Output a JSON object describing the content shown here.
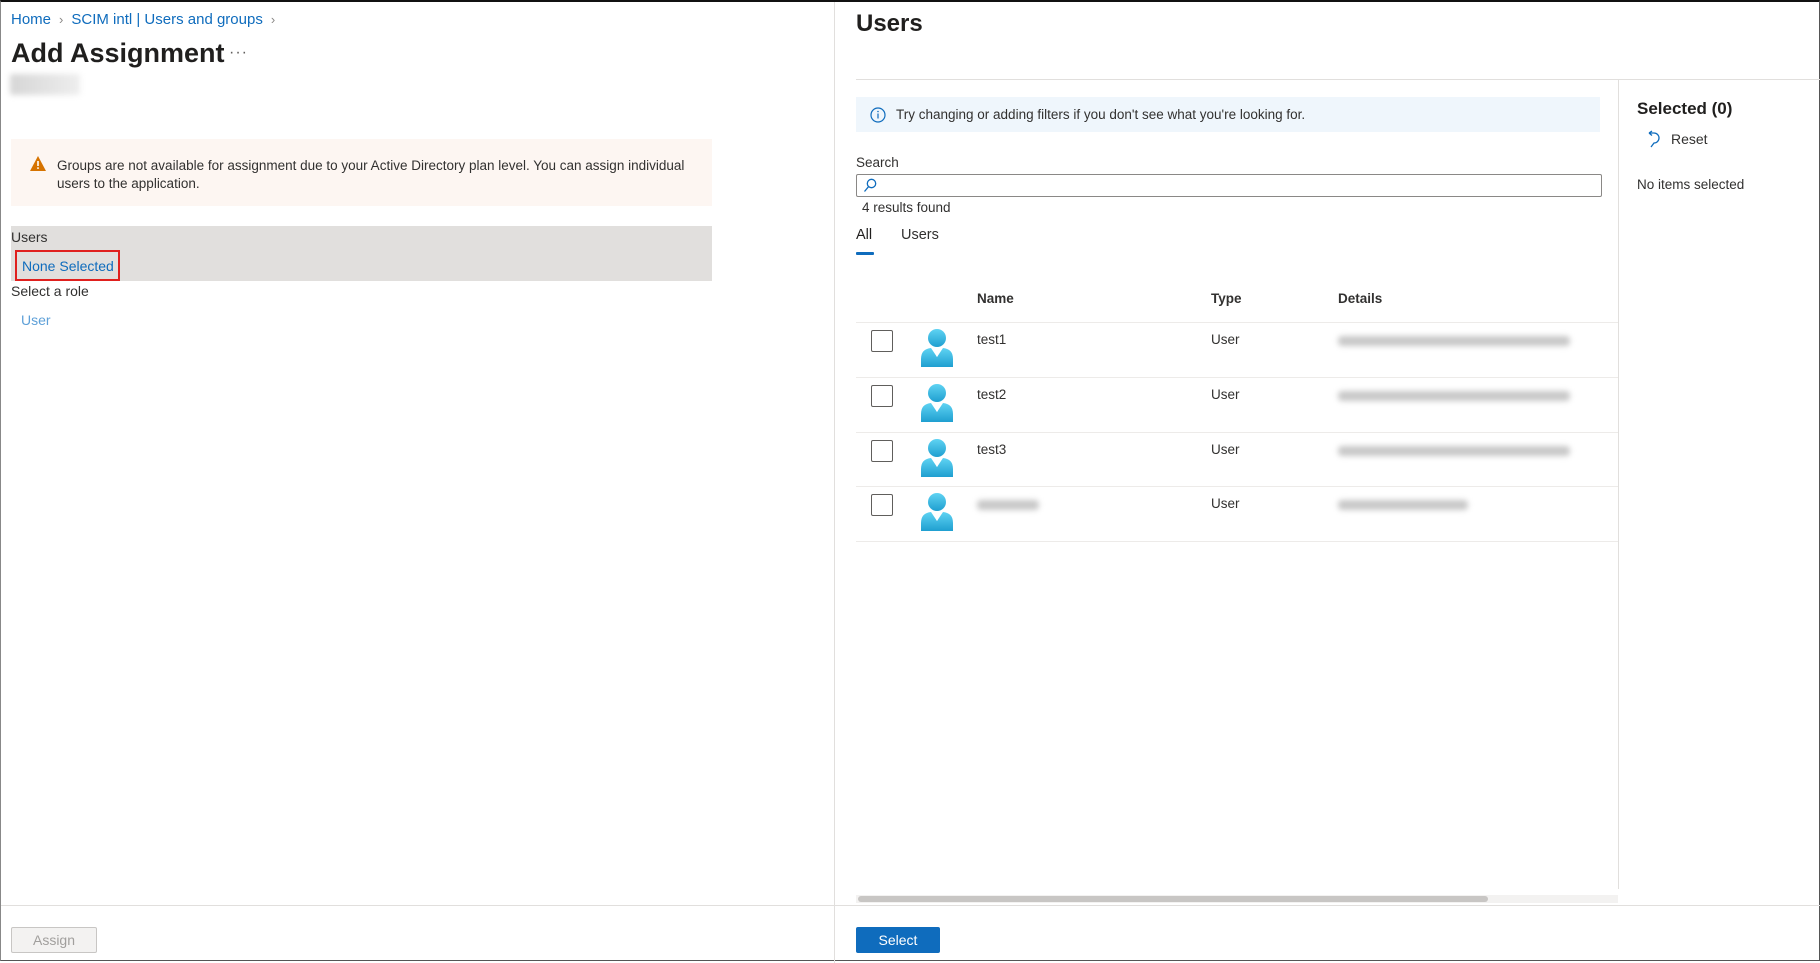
{
  "breadcrumb": [
    {
      "label": "Home"
    },
    {
      "label": "SCIM intl | Users and groups"
    }
  ],
  "left": {
    "title": "Add Assignment",
    "more": "···",
    "warning": "Groups are not available for assignment due to your Active Directory plan level. You can assign individual users to the application.",
    "users_label": "Users",
    "users_value": "None Selected",
    "role_label": "Select a role",
    "role_value": "User",
    "assign_label": "Assign"
  },
  "right": {
    "title": "Users",
    "info": "Try changing or adding filters if you don't see what you're looking for.",
    "search_label": "Search",
    "search_value": "",
    "results": "4 results found",
    "tabs": [
      {
        "label": "All",
        "active": true
      },
      {
        "label": "Users",
        "active": false
      }
    ],
    "columns": [
      "Name",
      "Type",
      "Details"
    ],
    "rows": [
      {
        "name": "test1",
        "type": "User"
      },
      {
        "name": "test2",
        "type": "User"
      },
      {
        "name": "test3",
        "type": "User"
      },
      {
        "name": "",
        "type": "User"
      }
    ],
    "selected_title": "Selected (0)",
    "reset_label": "Reset",
    "no_items": "No items selected",
    "select_label": "Select"
  },
  "colors": {
    "accent": "#0f6cbd",
    "warning_bg": "#fdf6f2",
    "info_bg": "#eff6fc",
    "highlight": "#e0201e"
  }
}
